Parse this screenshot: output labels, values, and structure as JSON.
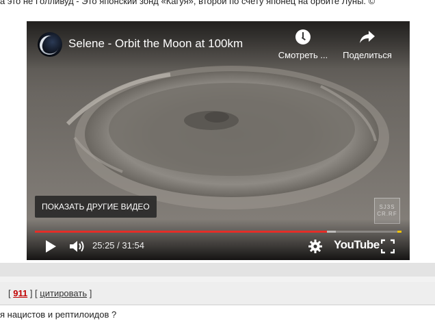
{
  "page": {
    "top_text": "а это не Голливуд - Это японский зонд «Кагуя», второй по счету японец на орбите Луны. ©",
    "bottom_text": "я нацистов и рептилоидов ?"
  },
  "player": {
    "title": "Selene - Orbit the Moon at 100km",
    "watch_later_label": "Смотреть ...",
    "share_label": "Поделиться",
    "more_videos_label": "ПОКАЗАТЬ ДРУГИЕ ВИДЕО",
    "watermark_text": "SJ3S CR.RF",
    "current_time": "25:25",
    "time_separator": " / ",
    "duration": "31:54",
    "progress_fraction": 0.797,
    "buffered_fraction": 0.82,
    "logo_text": "YouTube",
    "icons": {
      "play": "play-icon",
      "volume": "volume-icon",
      "settings": "gear-icon",
      "fullscreen": "fullscreen-icon",
      "watch_later": "clock-icon",
      "share": "share-arrow-icon"
    },
    "colors": {
      "progress": "#e52d27",
      "end_marker": "#f2c400"
    }
  },
  "post_meta": {
    "bracket_open": "[ ",
    "post_number": "911",
    "middle": " ] [ ",
    "quote_label": "цитировать",
    "bracket_close": " ]"
  }
}
